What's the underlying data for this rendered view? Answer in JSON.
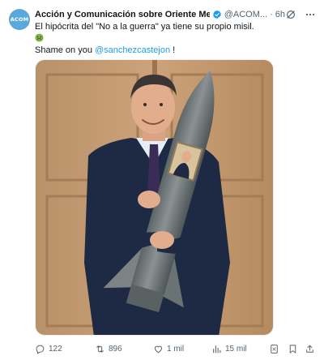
{
  "post": {
    "avatar_text": "ACOM",
    "author_name": "Acción y Comunicación sobre Oriente Medio -...",
    "handle": "@ACOM...",
    "separator": "·",
    "time": "6h",
    "text_line1": "El hipócrita del \"No a la guerra\" ya tiene su propio misil.",
    "text_prefix": "Shame on you ",
    "mention": "@sanchezcastejon",
    "text_suffix": " !",
    "media_alt": "Pedro Sánchez abrazando un misil",
    "stats": {
      "replies": "122",
      "reposts": "896",
      "likes": "1 mil",
      "views": "15 mil"
    }
  },
  "colors": {
    "accent": "#1d9bf0",
    "text_secondary": "#536471",
    "avatar": "#5aa8de"
  },
  "icons": [
    "verified-icon",
    "grok-icon",
    "more-icon",
    "nauseated-face-emoji",
    "reply-icon",
    "retweet-icon",
    "heart-icon",
    "views-icon",
    "grok-action-icon",
    "bookmark-icon",
    "share-icon"
  ]
}
